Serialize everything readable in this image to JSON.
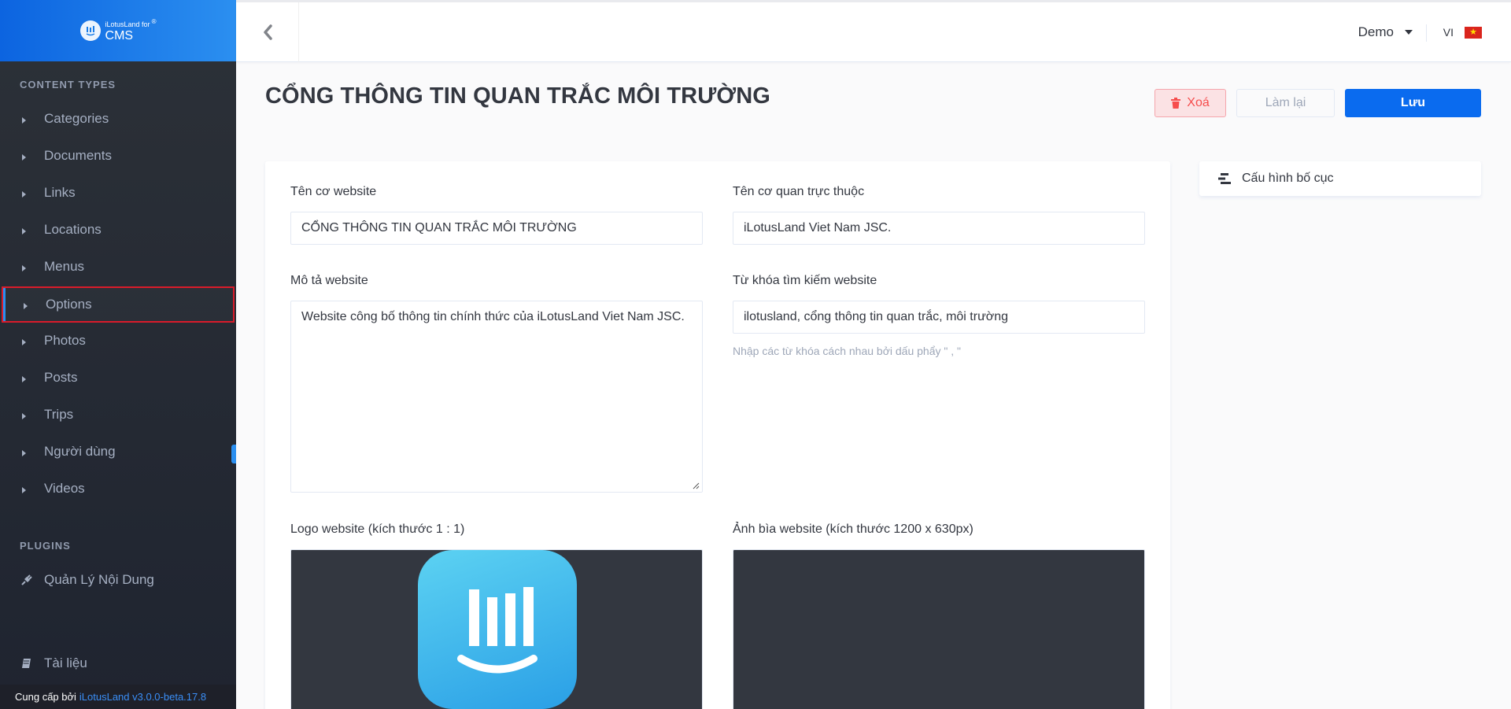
{
  "brand": {
    "small": "iLotusLand for",
    "big": "CMS",
    "reg": "®"
  },
  "sidebar": {
    "content_types_heading": "CONTENT TYPES",
    "items": [
      {
        "label": "Categories"
      },
      {
        "label": "Documents"
      },
      {
        "label": "Links"
      },
      {
        "label": "Locations"
      },
      {
        "label": "Menus"
      },
      {
        "label": "Options",
        "active": true
      },
      {
        "label": "Photos"
      },
      {
        "label": "Posts"
      },
      {
        "label": "Trips"
      },
      {
        "label": "Người dùng"
      },
      {
        "label": "Videos"
      }
    ],
    "plugins_heading": "PLUGINS",
    "plugins": [
      {
        "label": "Quản Lý Nội Dung",
        "icon": "plug-icon"
      },
      {
        "label": "Tài liệu",
        "icon": "book-icon"
      }
    ],
    "footer": {
      "prefix": "Cung cấp bởi",
      "version": "iLotusLand v3.0.0-beta.17.8"
    }
  },
  "topbar": {
    "user": "Demo",
    "lang": "VI",
    "flag": "vietnam-flag-icon"
  },
  "page": {
    "title": "CỔNG THÔNG TIN QUAN TRẮC MÔI TRƯỜNG",
    "delete_label": "Xoá",
    "reset_label": "Làm lại",
    "save_label": "Lưu"
  },
  "form": {
    "site_name_label": "Tên cơ website",
    "site_name_value": "CỔNG THÔNG TIN QUAN TRẮC MÔI TRƯỜNG",
    "org_label": "Tên cơ quan trực thuộc",
    "org_value": "iLotusLand Viet Nam JSC.",
    "desc_label": "Mô tả website",
    "desc_value": "Website công bố thông tin chính thức của iLotusLand Viet Nam JSC.",
    "keywords_label": "Từ khóa tìm kiếm website",
    "keywords_value": "ilotusland, cổng thông tin quan trắc, môi trường",
    "keywords_hint": "Nhập các từ khóa cách nhau bởi dấu phẩy \" , \"",
    "logo_label": "Logo website (kích thước 1 : 1)",
    "cover_label": "Ảnh bìa website (kích thước 1200 x 630px)"
  },
  "right_panel": {
    "layout_label": "Cấu hình bố cục"
  },
  "colors": {
    "primary": "#0a6bef",
    "danger": "#f64d4d",
    "sidebar": "#2c3138",
    "highlight": "#d91b2a"
  }
}
